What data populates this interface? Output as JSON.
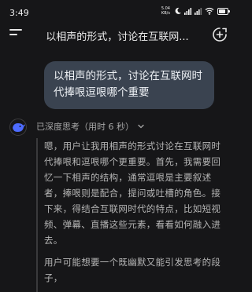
{
  "status_bar": {
    "time": "3:49",
    "net_speed_value": "5.04",
    "net_speed_unit": "KB/s",
    "battery_level": 0.8
  },
  "header": {
    "title": "以相声的形式，讨论在互联网..."
  },
  "user_message": {
    "text": "以相声的形式，讨论在互联网时代捧哏逗哏哪个重要"
  },
  "thinking": {
    "label": "已深度思考（用时 6 秒）",
    "paragraphs": [
      "嗯，用户让我用相声的形式讨论在互联网时代捧哏和逗哏哪个更重要。首先，我需要回忆一下相声的结构，通常逗哏是主要叙述者，捧哏则是配合，提问或吐槽的角色。接下来，得结合互联网时代的特点，比如短视频、弹幕、直播这些元素，看看如何融入进去。",
      "用户可能想要一个既幽默又能引发思考的段子，"
    ]
  },
  "icons": {
    "menu": "menu-icon",
    "new_chat": "new-chat-icon",
    "avatar": "deepseek-whale-icon",
    "chevron": "chevron-down-icon"
  },
  "colors": {
    "background": "#161618",
    "user_bubble": "#3a4350",
    "accent": "#4d6bfe"
  }
}
